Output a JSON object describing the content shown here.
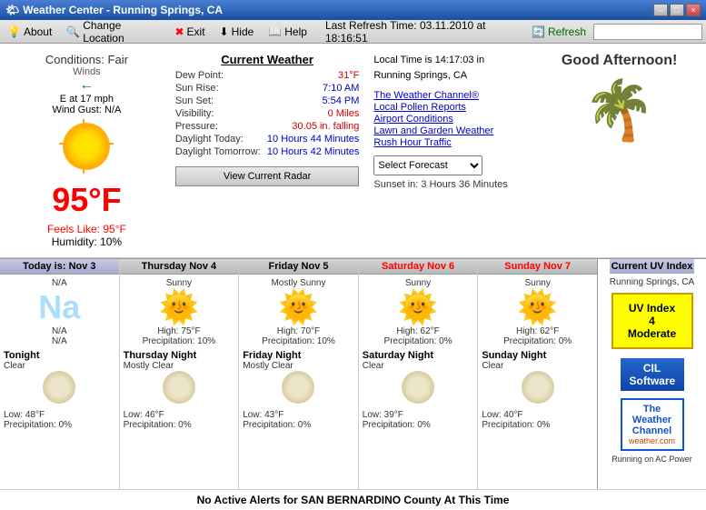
{
  "titlebar": {
    "title": "Weather Center - Running Springs, CA",
    "minimize": "–",
    "maximize": "□",
    "close": "×"
  },
  "menubar": {
    "about_label": "About",
    "change_location_label": "Change Location",
    "exit_label": "Exit",
    "hide_label": "Hide",
    "help_label": "Help",
    "last_refresh_label": "Last Refresh Time:",
    "last_refresh_value": "03.11.2010 at 18:16:51",
    "refresh_label": "Refresh"
  },
  "conditions": {
    "main": "Conditions: Fair",
    "winds_label": "Winds",
    "wind_dir": "E at 17 mph",
    "wind_gust": "Wind Gust: N/A",
    "temperature": "95°F",
    "feels_like_label": "Feels Like:",
    "feels_like_value": "95°F",
    "humidity_label": "Humidity:",
    "humidity_value": "10%"
  },
  "current_weather": {
    "title": "Current Weather",
    "dew_point_label": "Dew Point:",
    "dew_point_value": "31°F",
    "sun_rise_label": "Sun Rise:",
    "sun_rise_value": "7:10 AM",
    "sun_set_label": "Sun Set:",
    "sun_set_value": "5:54 PM",
    "visibility_label": "Visibility:",
    "visibility_value": "0 Miles",
    "pressure_label": "Pressure:",
    "pressure_value": "30.05 in. falling",
    "daylight_today_label": "Daylight Today:",
    "daylight_today_value": "10 Hours 44 Minutes",
    "daylight_tomorrow_label": "Daylight Tomorrow:",
    "daylight_tomorrow_value": "10 Hours 42 Minutes",
    "radar_button": "View Current Radar"
  },
  "local_info": {
    "local_time": "Local Time is 14:17:03 in",
    "location": "Running Springs, CA",
    "weather_channel": "The Weather Channel®",
    "local_pollen": "Local Pollen Reports",
    "airport_conditions": "Airport Conditions",
    "lawn_garden": "Lawn and Garden Weather",
    "rush_hour": "Rush Hour Traffic",
    "select_forecast": "Select Forecast",
    "sunset_text": "Sunset in: 3 Hours 36 Minutes"
  },
  "greeting": "Good Afternoon!",
  "forecast": {
    "days": [
      {
        "header": "Today is: Nov 3",
        "header_type": "today",
        "day_condition": "N/A",
        "high": "N/A",
        "precip": "N/A",
        "night_label": "Tonight",
        "night_condition": "Clear",
        "low": "Low: 48°F",
        "night_precip": "Precipitation: 0%",
        "na": true
      },
      {
        "header": "Thursday Nov 4",
        "header_type": "normal",
        "day_condition": "Sunny",
        "high": "High: 75°F",
        "precip": "Precipitation: 10%",
        "night_label": "Thursday Night",
        "night_condition": "Mostly Clear",
        "low": "Low: 46°F",
        "night_precip": "Precipitation: 0%",
        "na": false
      },
      {
        "header": "Friday Nov 5",
        "header_type": "normal",
        "day_condition": "Mostly Sunny",
        "high": "High: 70°F",
        "precip": "Precipitation: 10%",
        "night_label": "Friday Night",
        "night_condition": "Mostly Clear",
        "low": "Low: 43°F",
        "night_precip": "Precipitation: 0%",
        "na": false
      },
      {
        "header": "Saturday Nov 6",
        "header_type": "sat",
        "day_condition": "Sunny",
        "high": "High: 62°F",
        "precip": "Precipitation: 0%",
        "night_label": "Saturday Night",
        "night_condition": "Clear",
        "low": "Low: 39°F",
        "night_precip": "Precipitation: 0%",
        "na": false
      },
      {
        "header": "Sunday Nov 7",
        "header_type": "sun",
        "day_condition": "Sunny",
        "high": "High: 62°F",
        "precip": "Precipitation: 0%",
        "night_label": "Sunday Night",
        "night_condition": "Clear",
        "low": "Low: 40°F",
        "night_precip": "Precipitation: 0%",
        "na": false
      }
    ]
  },
  "uv_index": {
    "header": "Current UV Index",
    "location": "Running Springs, CA",
    "badge_line1": "UV Index",
    "badge_line2": "4 Moderate",
    "cil_line1": "CIL",
    "cil_line2": "Software",
    "twc_title": "The Weather Channel",
    "twc_url": "weather.com",
    "power_status": "Running on AC Power"
  },
  "alert": {
    "message": "No Active Alerts for SAN BERNARDINO County At This Time"
  }
}
